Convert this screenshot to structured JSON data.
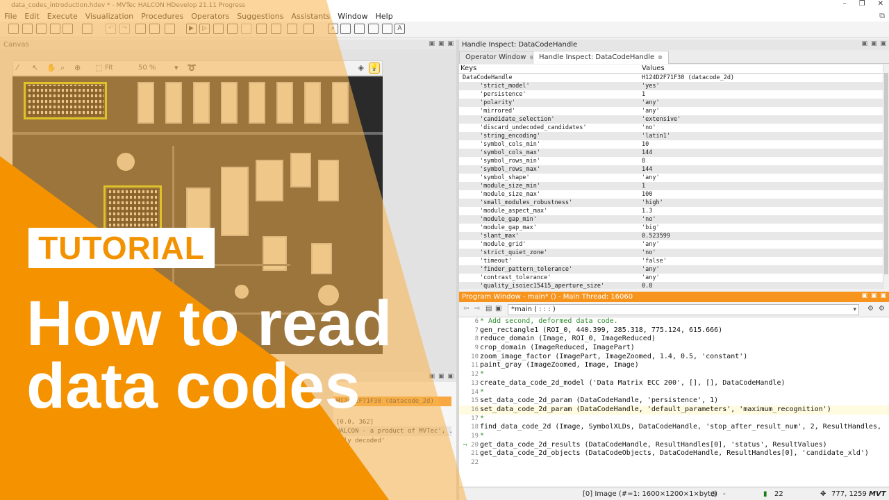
{
  "window": {
    "title": "data_codes_introduction.hdev * - MVTec HALCON HDevelop 21.11 Progress",
    "controls": [
      "–",
      "❐",
      "✕"
    ]
  },
  "menu": [
    "File",
    "Edit",
    "Execute",
    "Visualization",
    "Procedures",
    "Operators",
    "Suggestions",
    "Assistants",
    "Window",
    "Help"
  ],
  "canvas": {
    "label": "Canvas",
    "zoom_fit": "Fit",
    "zoom_level": "50 %"
  },
  "variables": {
    "rows": [
      "H124D2F71F30 (datacode_2d)",
      "[0.0, 362]",
      "HALCON - a product of MVTec', ...",
      "ully decoded'"
    ]
  },
  "handle_inspect": {
    "header": "Handle Inspect: DataCodeHandle",
    "tabs": [
      "Operator Window",
      "Handle Inspect: DataCodeHandle"
    ],
    "columns": [
      "Keys",
      "Values"
    ],
    "root_key": "DataCodeHandle",
    "root_value": "H124D2F71F30 (datacode_2d)",
    "rows": [
      {
        "k": "'strict_model'",
        "v": "'yes'"
      },
      {
        "k": "'persistence'",
        "v": "1"
      },
      {
        "k": "'polarity'",
        "v": "'any'"
      },
      {
        "k": "'mirrored'",
        "v": "'any'"
      },
      {
        "k": "'candidate_selection'",
        "v": "'extensive'"
      },
      {
        "k": "'discard_undecoded_candidates'",
        "v": "'no'"
      },
      {
        "k": "'string_encoding'",
        "v": "'latin1'"
      },
      {
        "k": "'symbol_cols_min'",
        "v": "10"
      },
      {
        "k": "'symbol_cols_max'",
        "v": "144"
      },
      {
        "k": "'symbol_rows_min'",
        "v": "8"
      },
      {
        "k": "'symbol_rows_max'",
        "v": "144"
      },
      {
        "k": "'symbol_shape'",
        "v": "'any'"
      },
      {
        "k": "'module_size_min'",
        "v": "1"
      },
      {
        "k": "'module_size_max'",
        "v": "100"
      },
      {
        "k": "'small_modules_robustness'",
        "v": "'high'"
      },
      {
        "k": "'module_aspect_max'",
        "v": "1.3"
      },
      {
        "k": "'module_gap_min'",
        "v": "'no'"
      },
      {
        "k": "'module_gap_max'",
        "v": "'big'"
      },
      {
        "k": "'slant_max'",
        "v": "0.523599"
      },
      {
        "k": "'module_grid'",
        "v": "'any'"
      },
      {
        "k": "'strict_quiet_zone'",
        "v": "'no'"
      },
      {
        "k": "'timeout'",
        "v": "'false'"
      },
      {
        "k": "'finder_pattern_tolerance'",
        "v": "'any'"
      },
      {
        "k": "'contrast_tolerance'",
        "v": "'any'"
      },
      {
        "k": "'quality_isoiec15415_aperture_size'",
        "v": "0.8"
      }
    ]
  },
  "program": {
    "header": "Program Window - main* () - Main Thread: 16060",
    "procedure": "*main ( : : : )",
    "lines": [
      {
        "n": "6",
        "t": "* Add second, deformed data code.",
        "c": true
      },
      {
        "n": "7",
        "t": "gen_rectangle1 (ROI_0, 440.399, 285.318, 775.124, 615.666)"
      },
      {
        "n": "8",
        "t": "reduce_domain (Image, ROI_0, ImageReduced)"
      },
      {
        "n": "9",
        "t": "crop_domain (ImageReduced, ImagePart)"
      },
      {
        "n": "10",
        "t": "zoom_image_factor (ImagePart, ImageZoomed, 1.4, 0.5, 'constant')"
      },
      {
        "n": "11",
        "t": "paint_gray (ImageZoomed, Image, Image)"
      },
      {
        "n": "12",
        "t": "*",
        "c": true
      },
      {
        "n": "13",
        "t": "create_data_code_2d_model ('Data Matrix ECC 200', [], [], DataCodeHandle)"
      },
      {
        "n": "14",
        "t": "*",
        "c": true
      },
      {
        "n": "15",
        "t": "set_data_code_2d_param (DataCodeHandle, 'persistence', 1)"
      },
      {
        "n": "16",
        "t": "set_data_code_2d_param (DataCodeHandle, 'default_parameters', 'maximum_recognition')",
        "hl": true
      },
      {
        "n": "17",
        "t": "*",
        "c": true
      },
      {
        "n": "18",
        "t": "find_data_code_2d (Image, SymbolXLDs, DataCodeHandle, 'stop_after_result_num', 2, ResultHandles,"
      },
      {
        "n": "19",
        "t": "*",
        "c": true
      },
      {
        "n": "20",
        "t": "get_data_code_2d_results (DataCodeHandle, ResultHandles[0], 'status', ResultValues)",
        "pc": true
      },
      {
        "n": "21",
        "t": "get_data_code_2d_objects (DataCodeObjects, DataCodeHandle, ResultHandles[0], 'candidate_xld')"
      },
      {
        "n": "22",
        "t": ""
      }
    ]
  },
  "status": {
    "image_info": "[0] Image (#=1: 1600×1200×1×byte)",
    "dash": "-",
    "value": "22",
    "coords": "777, 1259",
    "logo": "MVT"
  },
  "overlay": {
    "badge": "TUTORIAL",
    "headline_1": "How to read",
    "headline_2": "data codes",
    "colors": {
      "orange": "#f39200",
      "orange_light": "#f7b24a",
      "white": "#ffffff"
    }
  }
}
